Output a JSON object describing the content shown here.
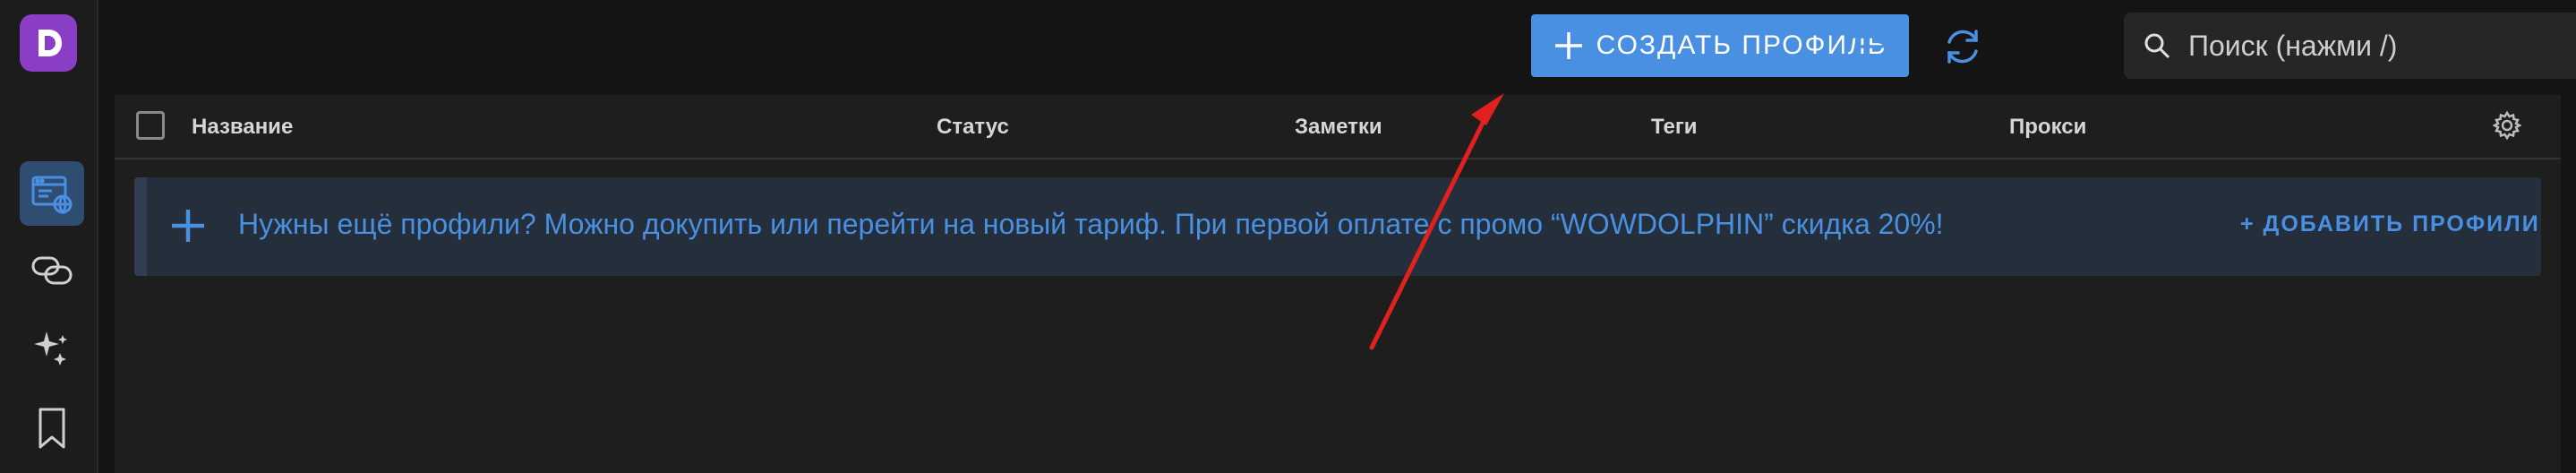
{
  "colors": {
    "accent": "#4a90e2",
    "background": "#141414",
    "panel": "#1e1e1e",
    "banner": "#252e3b",
    "logo": "#8a3ec6",
    "annotation_arrow": "#e0211f"
  },
  "sidebar": {
    "logo_icon": "dolphin-logo-icon",
    "items": [
      {
        "icon": "browser-profiles-icon",
        "active": true
      },
      {
        "icon": "link-icon",
        "active": false
      },
      {
        "icon": "sparkles-icon",
        "active": false
      },
      {
        "icon": "bookmark-icon",
        "active": false
      }
    ]
  },
  "toolbar": {
    "create_label": "СОЗДАТЬ ПРОФИЛЬ",
    "filter_icon": "filter-icon",
    "refresh_icon": "refresh-icon",
    "search_placeholder": "Поиск (нажми /)",
    "search_value": ""
  },
  "table": {
    "columns": [
      "Название",
      "Статус",
      "Заметки",
      "Теги",
      "Прокси"
    ],
    "settings_icon": "gear-icon"
  },
  "banner": {
    "text": "Нужны ещё профили? Можно докупить или перейти на новый тариф. При первой оплате с промо “WOWDOLPHIN” скидка 20%!",
    "action_label": "+ ДОБАВИТЬ ПРОФИЛИ"
  }
}
